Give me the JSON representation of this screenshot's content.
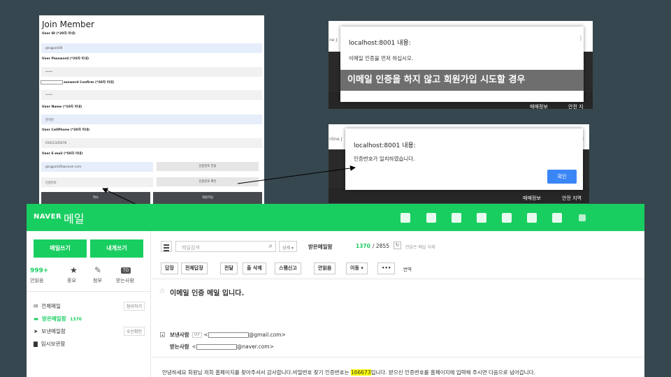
{
  "join_form": {
    "title": "Join Member",
    "user_id_label": "User ID (*20자 이내)",
    "user_id_value": "gksgpals06",
    "password_label": "User Password (*20자 이내)",
    "password_value": "••••",
    "confirm_label": "assword Confirm (*20자 이내)",
    "confirm_value": "••••",
    "name_label": "User Name (*10자 이내)",
    "name_value": "한지헌",
    "phone_label": "User CellPhone (*20자 이내)",
    "phone_value": "01012345678",
    "email_label": "User E-mail (*50자 이내)",
    "email_value": "gksgpals06@naver.com",
    "send_code_button": "인증번호 전송",
    "code_placeholder": "인증번호",
    "confirm_code_button": "인증번호 확인",
    "cancel_button": "취소",
    "submit_button": "회원가입"
  },
  "dialog_top": {
    "host": "localhost:8001 내용:",
    "message": "이메일 인증을 먼저 하십시오.",
    "annotation": "이메일 인증을 하지 않고 회원가입 시도할 경우",
    "side_text": "ne J",
    "strip_left": "매매정보",
    "strip_right": "안전 지"
  },
  "dialog_bottom": {
    "host": "localhost:8001 내용:",
    "message": "인증번호가 일치하였습니다.",
    "ok_button": "확인",
    "side_text": "nline J",
    "strip_left": "매매정보",
    "strip_right": "안전 지역",
    "corner_text": "TE"
  },
  "naver_mail": {
    "logo": "NAVER",
    "service": "메일",
    "write_button": "메일쓰기",
    "self_write_button": "내게쓰기",
    "unread_count": "999+",
    "unread_label": "안읽음",
    "important_label": "중요",
    "attach_label": "첨부",
    "to_me_badge": "TO",
    "to_me_label": "받는사람",
    "folders": [
      {
        "label": "전체메일",
        "button": "정리하기"
      },
      {
        "label": "받은메일함",
        "count": "1370"
      },
      {
        "label": "보낸메일함",
        "button": "수신확인"
      },
      {
        "label": "임시보관함"
      }
    ],
    "search_placeholder": "메일검색",
    "detail_button": "상세 ▾",
    "inbox_title": "받은메일함",
    "unread_in_inbox": "1370",
    "total_in_inbox": "/ 2855",
    "refresh_icon": "↻",
    "delete_read": "안읽은 메일 삭제",
    "toolbar": [
      "답장",
      "전체답장",
      "전달",
      "출 삭제",
      "스팸신고",
      "안읽음",
      "이동 ▾",
      "•••"
    ],
    "translate": "번역",
    "subject": "이메일 인증 메일 입니다.",
    "sender_label": "보낸사람",
    "vip_badge": "VIP",
    "sender_suffix": "@gmail.com>",
    "receiver_label": "받는사람",
    "receiver_suffix": "@naver.com>",
    "body_before": "안녕하세요 회원님 저희 홈페이지를 찾아주셔서 감사합니다.비밀번호 찾기 인증번호는 ",
    "body_code": "166673",
    "body_after": "입니다. 받으신 인증번호를 홈페이지에 입력해 주시면 다음으로 넘어갑니다."
  },
  "colors": {
    "background": "#37474f",
    "naver_green": "#19ce60",
    "dialog_button": "#3b86f7",
    "highlight": "#ffff00"
  }
}
